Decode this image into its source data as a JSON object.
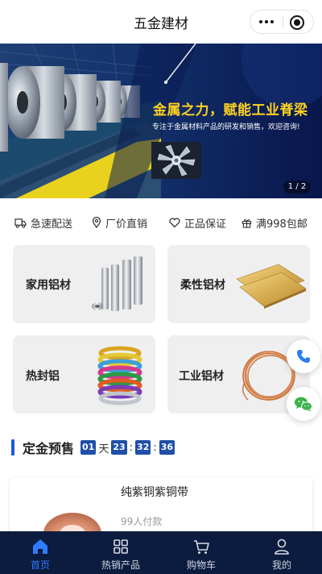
{
  "header": {
    "title": "五金建材",
    "more_icon": "more-dots-icon",
    "close_icon": "target-close-icon"
  },
  "banner": {
    "headline": "金属之力，赋能工业脊梁",
    "subtitle": "专注于金属材料产品的研发和销售，欢迎咨询!",
    "pager": "1 / 2",
    "colors": {
      "background": "#0b1f57",
      "headline": "#ffd21f",
      "stripe": "#e9d21d"
    }
  },
  "features": [
    {
      "icon": "truck-icon",
      "label": "急速配送"
    },
    {
      "icon": "location-pin-icon",
      "label": "厂价直销"
    },
    {
      "icon": "heart-shield-icon",
      "label": "正品保证"
    },
    {
      "icon": "gift-icon",
      "label": "满998包邮"
    }
  ],
  "categories": [
    {
      "label": "家用铝材",
      "image": "aluminum-rods"
    },
    {
      "label": "柔性铝材",
      "image": "copper-plates"
    },
    {
      "label": "热封铝",
      "image": "colored-wire-coils"
    },
    {
      "label": "工业铝材",
      "image": "copper-wire-coil"
    }
  ],
  "floating": {
    "phone_icon": "phone-icon",
    "wechat_icon": "wechat-icon"
  },
  "presale": {
    "title": "定金预售",
    "countdown": {
      "days": "01",
      "day_unit": "天",
      "hours": "23",
      "minutes": "32",
      "seconds": "36",
      "separator": ":"
    }
  },
  "product": {
    "name": "纯紫铜紫铜带",
    "paid": "99人付款"
  },
  "tabbar": [
    {
      "icon": "home-icon",
      "label": "首页",
      "active": true
    },
    {
      "icon": "grid-icon",
      "label": "热销产品",
      "active": false
    },
    {
      "icon": "cart-icon",
      "label": "购物车",
      "active": false
    },
    {
      "icon": "user-icon",
      "label": "我的",
      "active": false
    }
  ],
  "colors": {
    "accent": "#1f5bd6",
    "tabbar_bg": "#0c1c3f",
    "tab_active": "#2f7cff",
    "card_bg": "#efefef"
  }
}
